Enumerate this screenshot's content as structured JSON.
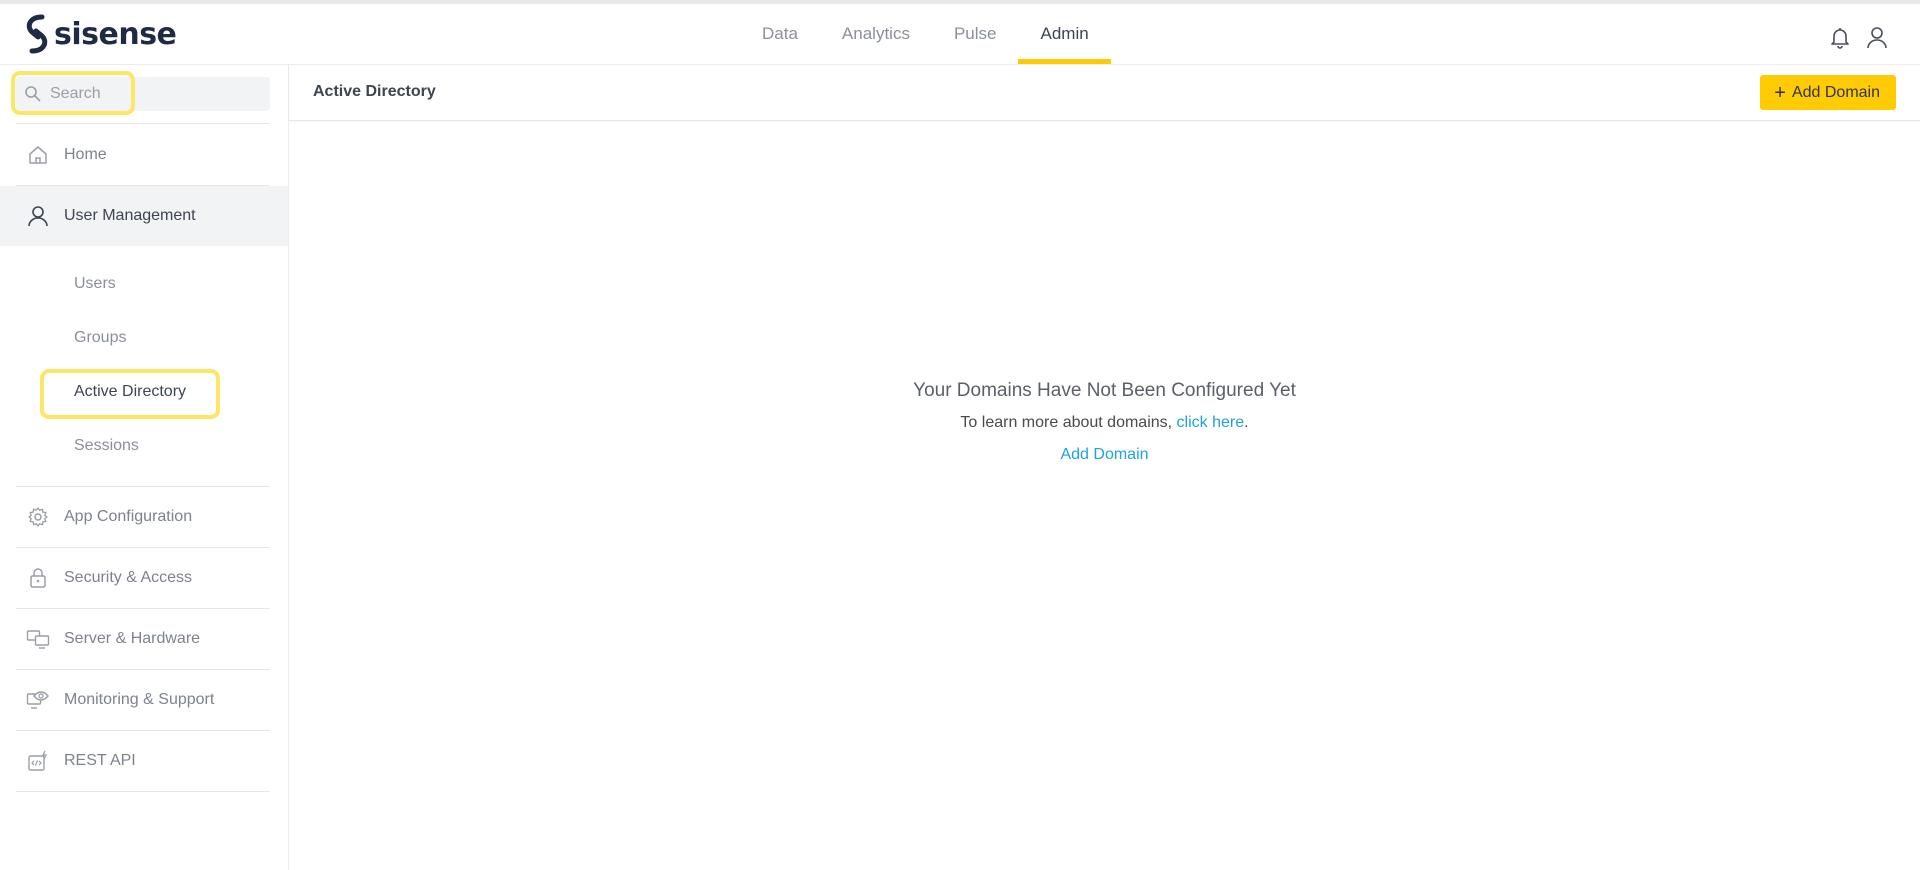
{
  "app": {
    "brand": "sisense",
    "colors": {
      "accent": "#ffcb05",
      "link": "#1fa3e0",
      "text": "#3d4452",
      "highlight": "#ffe566"
    }
  },
  "topnav": {
    "tabs": [
      {
        "label": "Data"
      },
      {
        "label": "Analytics"
      },
      {
        "label": "Pulse"
      },
      {
        "label": "Admin",
        "active": true
      }
    ],
    "icons": [
      "bell-icon",
      "user-icon"
    ]
  },
  "sidebar": {
    "search": {
      "placeholder": "Search",
      "value": ""
    },
    "items": [
      {
        "label": "Home",
        "icon": "home-icon"
      },
      {
        "label": "User Management",
        "icon": "user-icon",
        "selected": true
      },
      {
        "label": "App Configuration",
        "icon": "gear-icon"
      },
      {
        "label": "Security & Access",
        "icon": "lock-icon"
      },
      {
        "label": "Server & Hardware",
        "icon": "monitors-icon"
      },
      {
        "label": "Monitoring & Support",
        "icon": "eye-monitor-icon"
      },
      {
        "label": "REST API",
        "icon": "api-icon"
      }
    ],
    "subitems": [
      {
        "label": "Users"
      },
      {
        "label": "Groups"
      },
      {
        "label": "Active Directory",
        "active": true
      },
      {
        "label": "Sessions"
      }
    ]
  },
  "main": {
    "title": "Active Directory",
    "add_button": "Add Domain",
    "empty_state": {
      "title": "Your Domains Have Not Been Configured Yet",
      "info_prefix": "To learn more about domains, ",
      "info_link": "click here",
      "info_suffix": ".",
      "add_link": "Add Domain"
    }
  }
}
